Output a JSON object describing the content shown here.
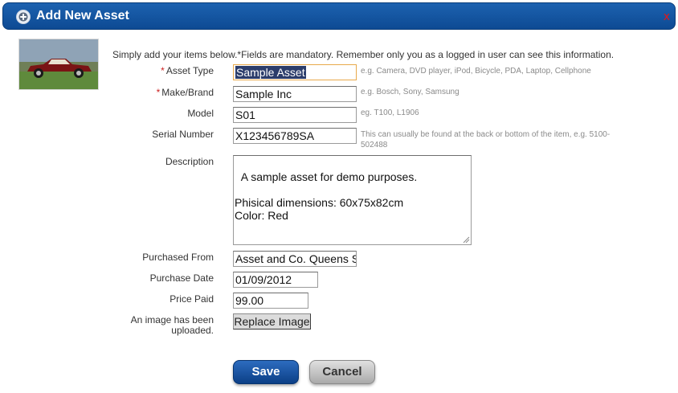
{
  "dialog": {
    "title": "Add New Asset",
    "close_label": "x"
  },
  "intro": "Simply add your items below.*Fields are mandatory. Remember only you as a logged in user can see this information.",
  "form": {
    "asset_type": {
      "label": "Asset Type",
      "required": "*",
      "value": "Sample Asset",
      "hint": "e.g. Camera, DVD player, iPod, Bicycle, PDA, Laptop, Cellphone"
    },
    "make_brand": {
      "label": "Make/Brand",
      "required": "*",
      "value": "Sample Inc",
      "hint": "e.g. Bosch, Sony, Samsung"
    },
    "model": {
      "label": "Model",
      "value": "S01",
      "hint": "eg. T100, L1906"
    },
    "serial_number": {
      "label": "Serial Number",
      "value": "X123456789SA",
      "hint": "This can usually be found at the back or bottom of the item, e.g. 5100-502488"
    },
    "description": {
      "label": "Description",
      "value": "A sample asset for demo purposes.\n\nPhisical dimensions: 60x75x82cm\nColor: Red"
    },
    "purchased_from": {
      "label": "Purchased From",
      "value": "Asset and Co. Queens S"
    },
    "purchase_date": {
      "label": "Purchase Date",
      "value": "01/09/2012"
    },
    "price_paid": {
      "label": "Price Paid",
      "value": "99.00"
    },
    "image": {
      "label_line1": "An image has been",
      "label_line2": "uploaded.",
      "button_label": "Replace Image"
    }
  },
  "actions": {
    "save_label": "Save",
    "cancel_label": "Cancel"
  },
  "colors": {
    "title_bar": "#0d4a93",
    "save_button": "#0b3f86",
    "cancel_button": "#a9a9a9",
    "required_marker": "#cc2222",
    "close_x": "#e01818"
  },
  "icons": {
    "title_icon": "add-icon",
    "close_icon": "close-icon",
    "thumbnail": "car-image"
  }
}
